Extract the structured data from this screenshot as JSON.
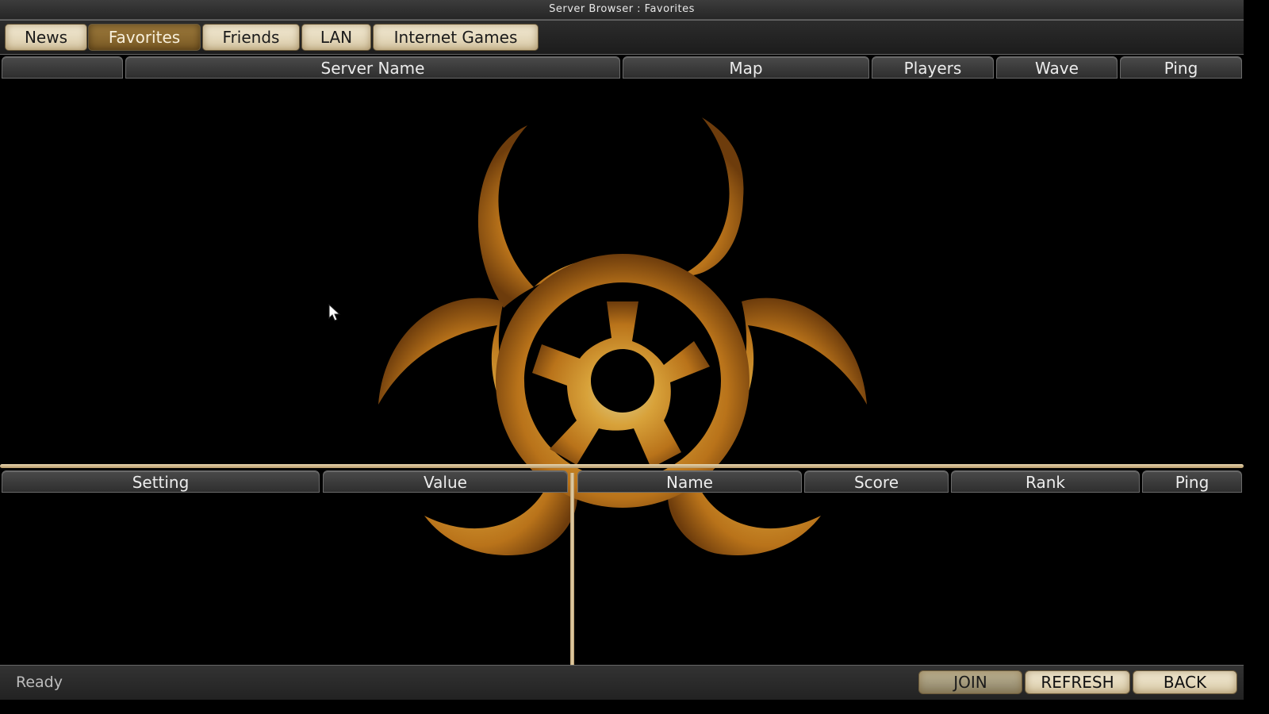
{
  "window": {
    "title": "Server Browser : Favorites"
  },
  "tabs": [
    {
      "label": "News",
      "active": false
    },
    {
      "label": "Favorites",
      "active": true
    },
    {
      "label": "Friends",
      "active": false
    },
    {
      "label": "LAN",
      "active": false
    },
    {
      "label": "Internet Games",
      "active": false
    }
  ],
  "server_list": {
    "columns": [
      "",
      "Server Name",
      "Map",
      "Players",
      "Wave",
      "Ping"
    ],
    "rows": []
  },
  "settings_list": {
    "columns": [
      "Setting",
      "Value"
    ],
    "rows": []
  },
  "players_list": {
    "columns": [
      "Name",
      "Score",
      "Rank",
      "Ping"
    ],
    "rows": []
  },
  "background": {
    "emblem_icon": "biohazard-icon",
    "emblem_color": "#c88a1e"
  },
  "status": {
    "text": "Ready"
  },
  "buttons": {
    "join": "JOIN",
    "refresh": "REFRESH",
    "back": "BACK"
  },
  "colors": {
    "accent": "#d8c9a6",
    "active_tab": "#8a6a30",
    "panel": "#2a2a2a"
  }
}
